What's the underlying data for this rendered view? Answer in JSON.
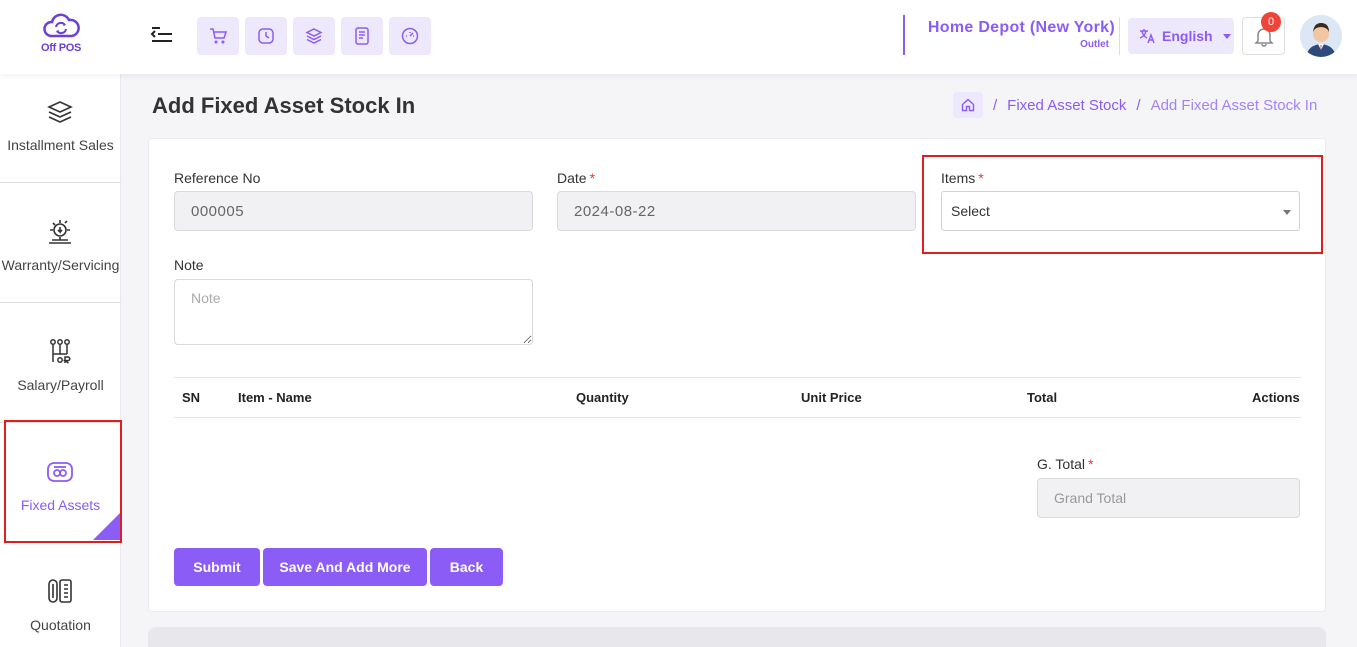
{
  "header": {
    "logo_text": "Off POS",
    "quick_buttons": [
      "cart-icon",
      "clock-icon",
      "layers-icon",
      "document-icon",
      "dashboard-icon"
    ],
    "outlet_name": "Home Depot (New York)",
    "outlet_sub": "Outlet",
    "language": "English",
    "notification_count": "0"
  },
  "sidebar": {
    "items": [
      {
        "label": "Installment Sales",
        "icon": "layers-icon"
      },
      {
        "label": "Warranty/Servicing",
        "icon": "service-icon"
      },
      {
        "label": "Salary/Payroll",
        "icon": "payroll-icon"
      },
      {
        "label": "Fixed Assets",
        "icon": "assets-icon",
        "active": true
      },
      {
        "label": "Quotation",
        "icon": "quotation-icon"
      }
    ]
  },
  "page": {
    "title": "Add Fixed Asset Stock In",
    "breadcrumb": [
      "Fixed Asset Stock",
      "Add Fixed Asset Stock In"
    ]
  },
  "form": {
    "reference_label": "Reference No",
    "reference_value": "000005",
    "date_label": "Date",
    "date_value": "2024-08-22",
    "items_label": "Items",
    "items_value": "Select",
    "note_label": "Note",
    "note_placeholder": "Note",
    "required_mark": "*"
  },
  "table": {
    "headers": [
      "SN",
      "Item - Name",
      "Quantity",
      "Unit Price",
      "Total",
      "Actions"
    ]
  },
  "totals": {
    "label": "G. Total",
    "placeholder": "Grand Total"
  },
  "buttons": {
    "submit": "Submit",
    "save_add_more": "Save And Add More",
    "back": "Back"
  },
  "colors": {
    "accent": "#8b5cf6",
    "accent_light": "#ede8fb",
    "highlight": "#e01e1e"
  }
}
